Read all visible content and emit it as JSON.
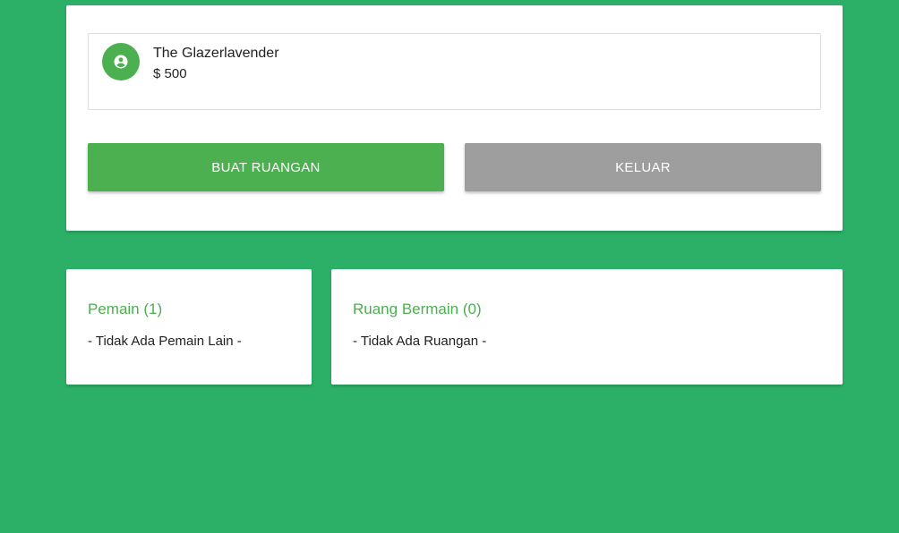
{
  "profile": {
    "name": "The Glazerlavender",
    "money": "$ 500",
    "avatar_icon": "account-circle-icon"
  },
  "actions": {
    "create_room_label": "BUAT RUANGAN",
    "logout_label": "KELUAR"
  },
  "players": {
    "title": "Pemain (1)",
    "empty_text": "- Tidak Ada Pemain Lain -"
  },
  "rooms": {
    "title": "Ruang Bermain (0)",
    "empty_text": "- Tidak Ada Ruangan -"
  },
  "colors": {
    "background": "#2cb068",
    "accent": "#4caf50",
    "secondary_button": "#9e9e9e"
  }
}
